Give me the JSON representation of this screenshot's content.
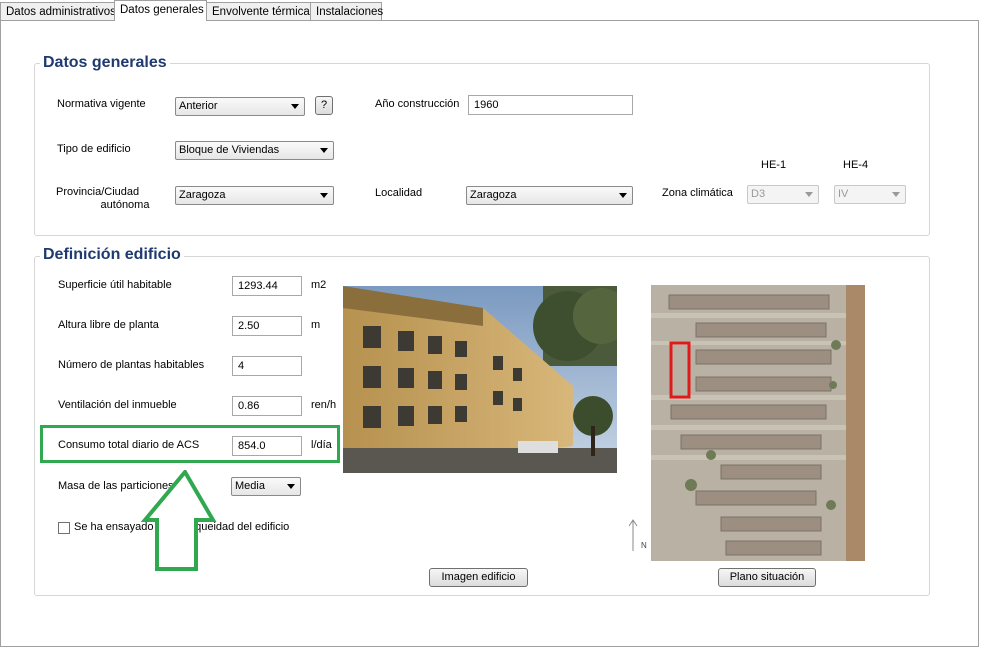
{
  "tabs": [
    {
      "label": "Datos administrativos"
    },
    {
      "label": "Datos generales"
    },
    {
      "label": "Envolvente térmica"
    },
    {
      "label": "Instalaciones"
    }
  ],
  "datos_generales": {
    "title": "Datos generales",
    "normativa_label": "Normativa vigente",
    "normativa_value": "Anterior",
    "help_button": "?",
    "anio_label": "Año construcción",
    "anio_value": "1960",
    "tipo_label": "Tipo de edificio",
    "tipo_value": "Bloque de Viviendas",
    "provincia_label_line1": "Provincia/Ciudad",
    "provincia_label_line2": "autónoma",
    "provincia_value": "Zaragoza",
    "localidad_label": "Localidad",
    "localidad_value": "Zaragoza",
    "zona_label": "Zona climática",
    "he1_label": "HE-1",
    "he1_value": "D3",
    "he4_label": "HE-4",
    "he4_value": "IV"
  },
  "definicion": {
    "title": "Definición edificio",
    "superficie_label": "Superficie útil habitable",
    "superficie_value": "1293.44",
    "superficie_unit": "m2",
    "altura_label": "Altura libre de planta",
    "altura_value": "2.50",
    "altura_unit": "m",
    "plantas_label": "Número de plantas habitables",
    "plantas_value": "4",
    "ventilacion_label": "Ventilación del inmueble",
    "ventilacion_value": "0.86",
    "ventilacion_unit": "ren/h",
    "consumo_label": "Consumo total diario de ACS",
    "consumo_value": "854.0",
    "consumo_unit": "l/día",
    "masa_label": "Masa de las particiones",
    "masa_value": "Media",
    "ensayado_label": "Se ha ensayado la estanqueidad del edificio",
    "imagen_button": "Imagen edificio",
    "plano_button": "Plano situación",
    "north_label": "N"
  },
  "colors": {
    "title": "#1e3a6e",
    "highlight": "#2fa84f",
    "map_marker": "#e01a1a"
  }
}
